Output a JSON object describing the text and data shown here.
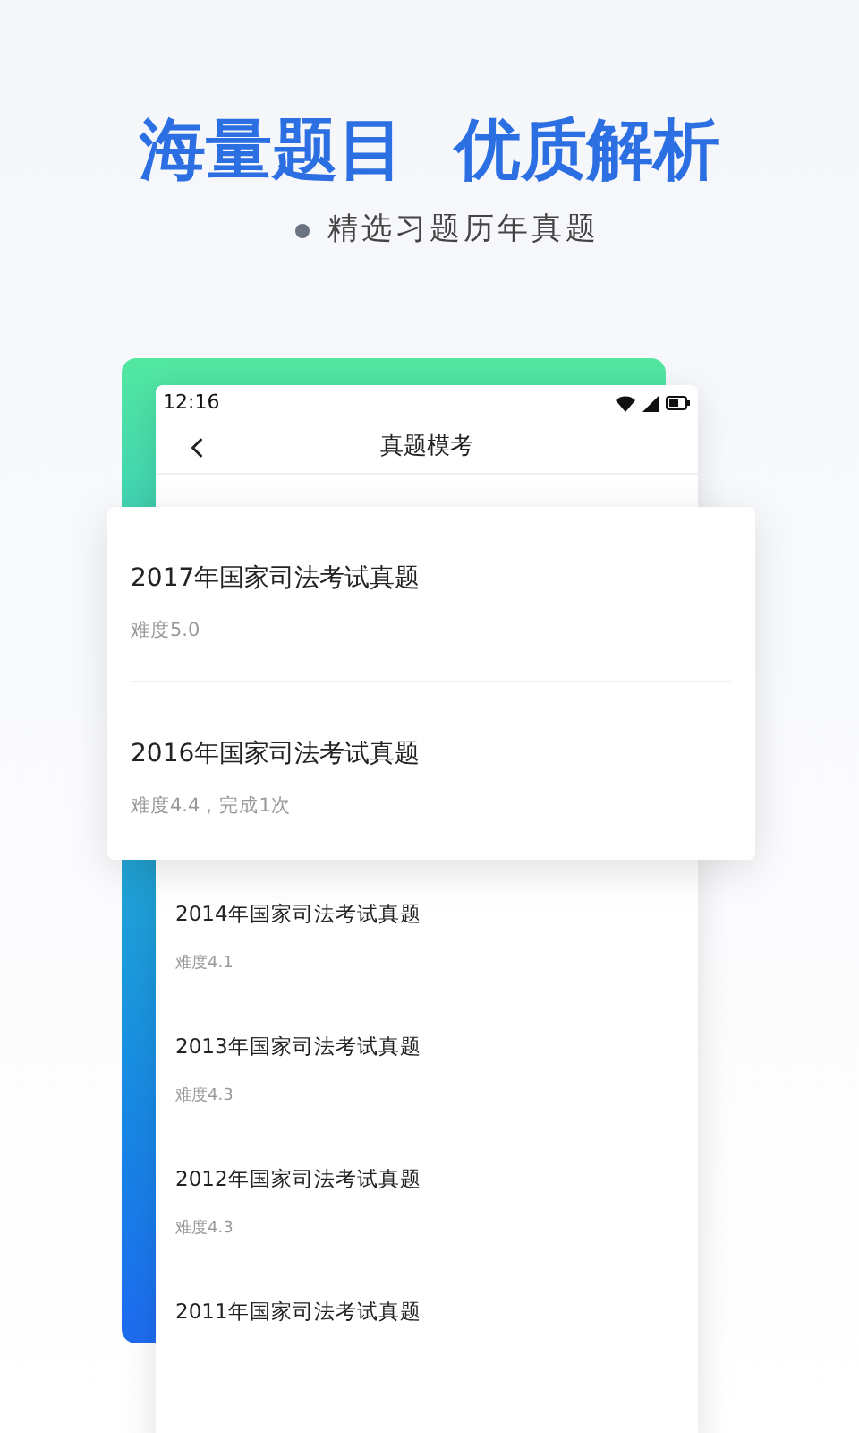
{
  "headline": {
    "left": "海量题目",
    "right": "优质解析"
  },
  "subtitle": "精选习题历年真题",
  "phone": {
    "status_bar": {
      "time": "12:16"
    },
    "nav": {
      "title": "真题模考"
    },
    "list": [
      {
        "title": "2014年国家司法考试真题",
        "detail": "难度4.1"
      },
      {
        "title": "2013年国家司法考试真题",
        "detail": "难度4.3"
      },
      {
        "title": "2012年国家司法考试真题",
        "detail": "难度4.3"
      },
      {
        "title": "2011年国家司法考试真题"
      }
    ]
  },
  "highlight_card": [
    {
      "title": "2017年国家司法考试真题",
      "detail": "难度5.0"
    },
    {
      "title": "2016年国家司法考试真题",
      "detail": "难度4.4，完成1次"
    }
  ]
}
